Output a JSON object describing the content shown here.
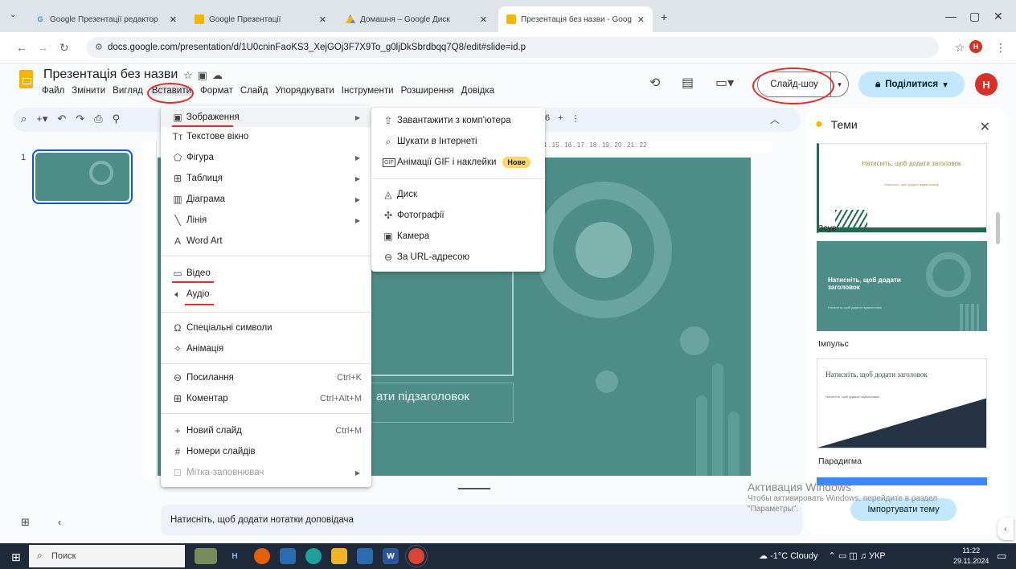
{
  "browser": {
    "tabs": [
      {
        "title": "Google Презентації редактор",
        "favicon": "google-g"
      },
      {
        "title": "Google Презентації",
        "favicon": "slides-icon"
      },
      {
        "title": "Домашня – Google Диск",
        "favicon": "drive-icon"
      },
      {
        "title": "Презентація без назви - Goog",
        "favicon": "slides-icon",
        "active": true
      }
    ],
    "url": "docs.google.com/presentation/d/1U0cninFaoKS3_XejGOj3F7X9To_g0ljDkSbrdbqq7Q8/edit#slide=id.p"
  },
  "doc": {
    "title": "Презентація без назви",
    "menus": [
      "Файл",
      "Змінити",
      "Вигляд",
      "Вставити",
      "Формат",
      "Слайд",
      "Упорядкувати",
      "Інструменти",
      "Розширення",
      "Довідка"
    ],
    "slideshow_label": "Слайд-шоу",
    "share_label": "Поділитися",
    "avatar_letter": "Н"
  },
  "toolbar": {
    "zoom_value": "6",
    "ruler_ticks": "3 . 14 . 15 . 16 . 17 . 18 . 19 . 20 . 21 . 22"
  },
  "filmstrip": {
    "slide_number": "1"
  },
  "slide": {
    "subtitle_placeholder": "ати підзаголовок"
  },
  "notes": {
    "placeholder": "Натисніть, щоб додати нотатки доповідача"
  },
  "insert_menu": {
    "items": [
      {
        "label": "Зображення",
        "icon": "image-icon",
        "submenu": true
      },
      {
        "label": "Текстове вікно",
        "icon": "text-box-icon"
      },
      {
        "label": "Фігура",
        "icon": "shape-icon",
        "submenu": true
      },
      {
        "label": "Таблиця",
        "icon": "table-icon",
        "submenu": true
      },
      {
        "label": "Діаграма",
        "icon": "chart-icon",
        "submenu": true
      },
      {
        "label": "Лінія",
        "icon": "line-icon",
        "submenu": true
      },
      {
        "label": "Word Art",
        "icon": "word-art-icon"
      },
      {
        "label": "Відео",
        "icon": "video-icon"
      },
      {
        "label": "Аудіо",
        "icon": "audio-icon"
      },
      {
        "label": "Спеціальні символи",
        "icon": "omega-icon"
      },
      {
        "label": "Анімація",
        "icon": "animation-icon"
      },
      {
        "label": "Посилання",
        "icon": "link-icon",
        "shortcut": "Ctrl+K"
      },
      {
        "label": "Коментар",
        "icon": "comment-icon",
        "shortcut": "Ctrl+Alt+M"
      },
      {
        "label": "Новий слайд",
        "icon": "plus-icon",
        "shortcut": "Ctrl+M"
      },
      {
        "label": "Номери слайдів",
        "icon": "hash-icon"
      },
      {
        "label": "Мітка-заповнювач",
        "icon": "placeholder-icon",
        "submenu": true,
        "disabled": true
      }
    ]
  },
  "image_submenu": {
    "items": [
      {
        "label": "Завантажити з комп'ютера",
        "icon": "upload-icon"
      },
      {
        "label": "Шукати в Інтернеті",
        "icon": "search-icon"
      },
      {
        "label": "Анімації GIF і наклейки",
        "icon": "gif-icon",
        "badge": "Нове"
      },
      {
        "label": "Диск",
        "icon": "drive-icon"
      },
      {
        "label": "Фотографії",
        "icon": "photos-icon"
      },
      {
        "label": "Камера",
        "icon": "camera-icon"
      },
      {
        "label": "За URL-адресою",
        "icon": "link-icon"
      }
    ]
  },
  "themes_panel": {
    "title": "Теми",
    "themes": [
      {
        "name": "",
        "preview_title": "Натисніть, щоб додати заголовок",
        "preview_subtitle": "Натисніть, щоб додати підзаголовок"
      },
      {
        "name": "Зсув",
        "preview_title": "Натисніть, щоб додати заголовок",
        "preview_subtitle": "Натисніть, щоб додати підзаголовок"
      },
      {
        "name": "Імпульс",
        "preview_title": "Натисніть, щоб додати заголовок",
        "preview_subtitle": "Натисніть, щоб додати підзаголовок"
      },
      {
        "name": "Парадигма",
        "preview_title": "",
        "preview_subtitle": ""
      }
    ],
    "import_label": "Імпортувати тему"
  },
  "watermark": {
    "line1": "Активация Windows",
    "line2": "Чтобы активировать Windows, перейдите в раздел \"Параметры\"."
  },
  "taskbar": {
    "search_label": "Поиск",
    "weather": "-1°C Cloudy",
    "lang": "УКР",
    "time": "11:22",
    "date": "29.11.2024"
  },
  "colors": {
    "slide_bg": "#4e8c88",
    "annotation_red": "#e52b2b",
    "share_btn": "#c2e7ff",
    "badge": "#fdd663"
  }
}
